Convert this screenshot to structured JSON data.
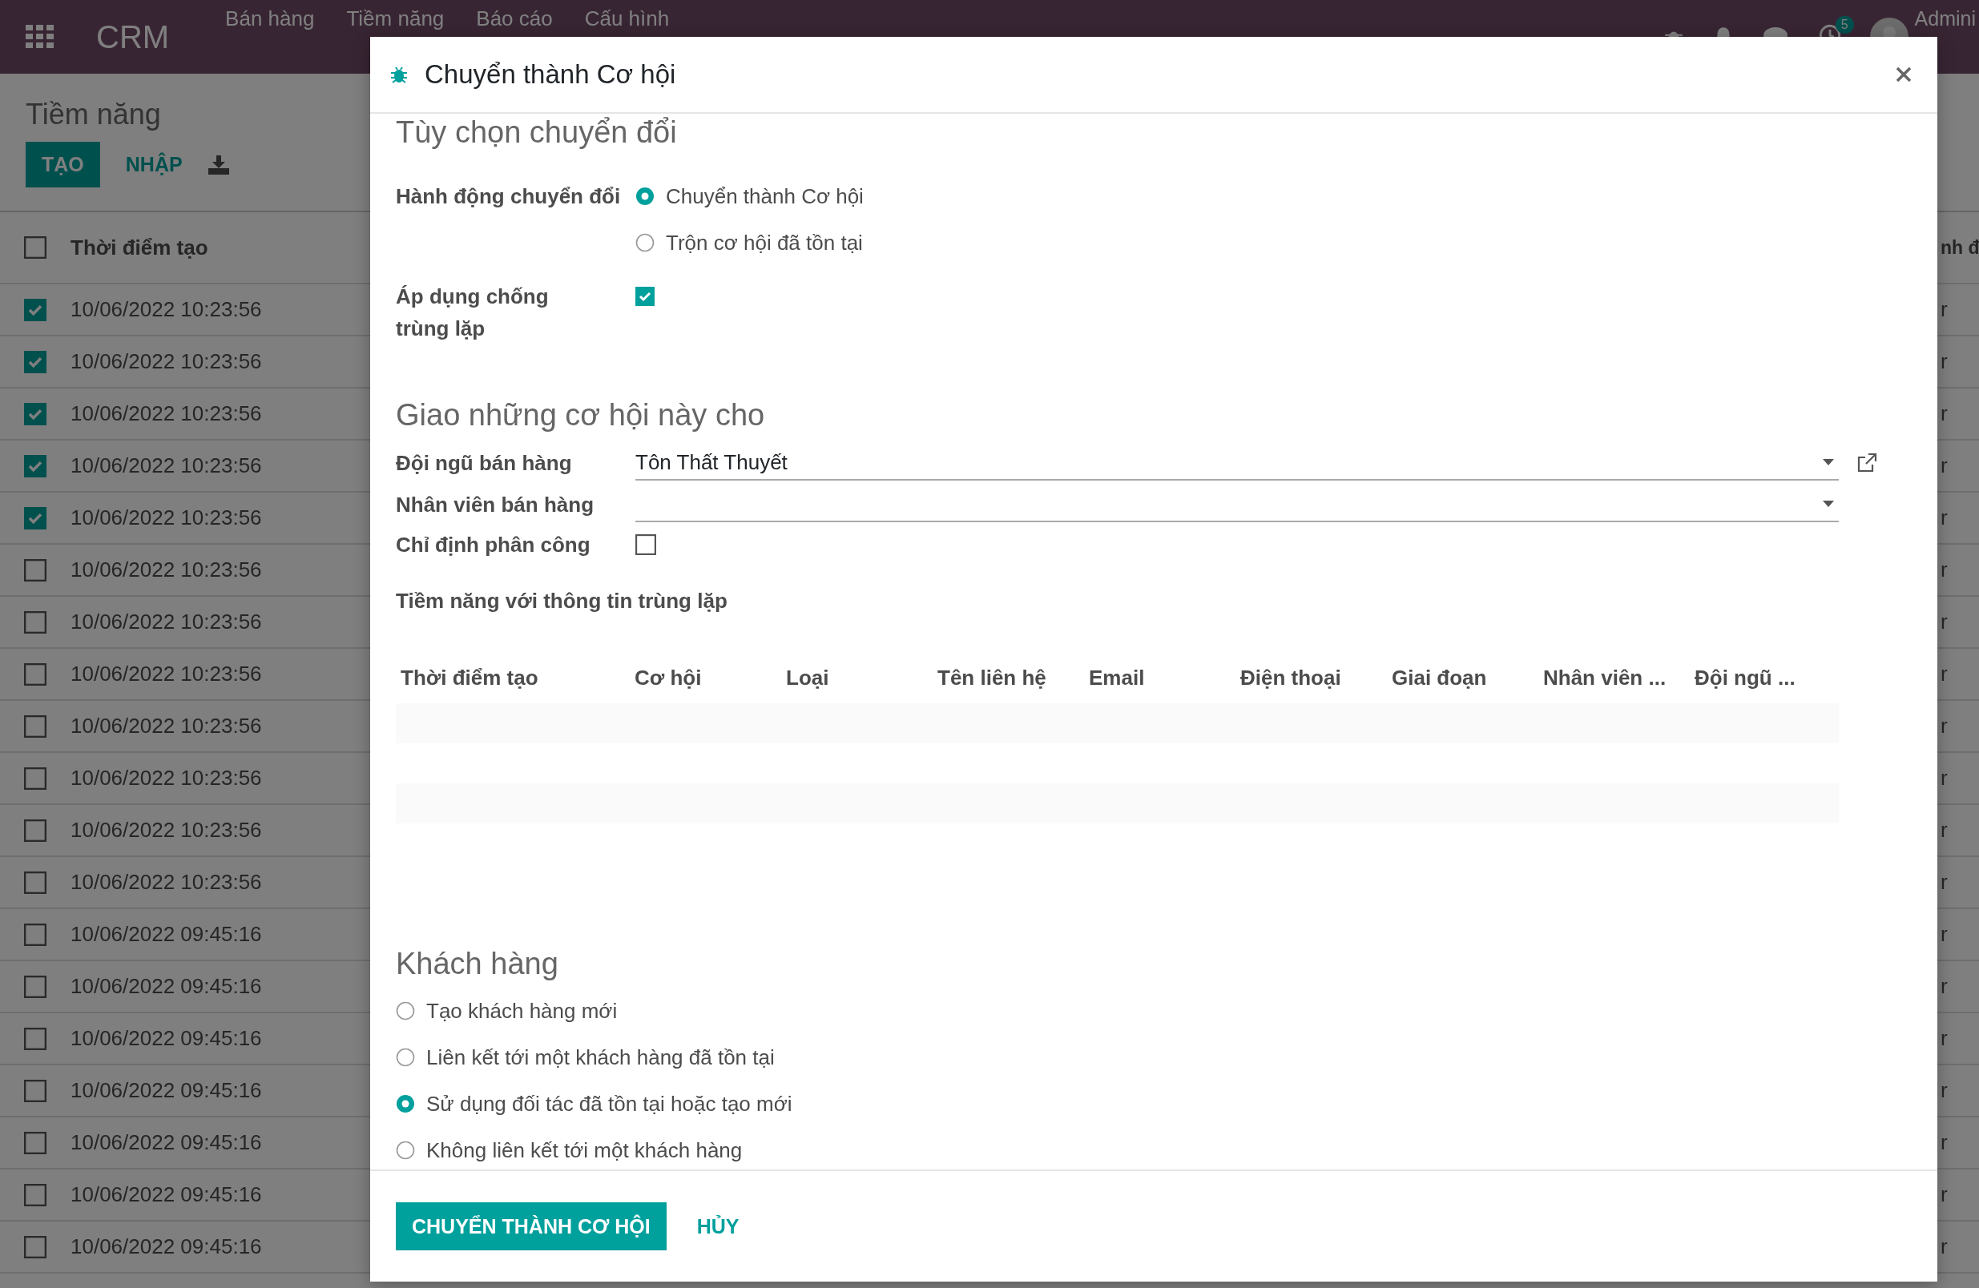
{
  "navbar": {
    "app_name": "CRM",
    "menu": [
      "Bán hàng",
      "Tiềm năng",
      "Báo cáo",
      "Cấu hình"
    ],
    "activity_count": "5",
    "user": "Admini"
  },
  "list_view": {
    "title": "Tiềm năng",
    "create_button": "TẠO",
    "import_button": "NHẬP",
    "columns": [
      "Thời điểm tạo",
      "nh đ"
    ],
    "select_all": false,
    "rows": [
      {
        "created": "10/06/2022 10:23:56",
        "column_2": "r",
        "selected": true
      },
      {
        "created": "10/06/2022 10:23:56",
        "column_2": "r",
        "selected": true
      },
      {
        "created": "10/06/2022 10:23:56",
        "column_2": "r",
        "selected": true
      },
      {
        "created": "10/06/2022 10:23:56",
        "column_2": "r",
        "selected": true
      },
      {
        "created": "10/06/2022 10:23:56",
        "column_2": "r",
        "selected": true
      },
      {
        "created": "10/06/2022 10:23:56",
        "column_2": "r",
        "selected": false
      },
      {
        "created": "10/06/2022 10:23:56",
        "column_2": "r",
        "selected": false
      },
      {
        "created": "10/06/2022 10:23:56",
        "column_2": "r",
        "selected": false
      },
      {
        "created": "10/06/2022 10:23:56",
        "column_2": "r",
        "selected": false
      },
      {
        "created": "10/06/2022 10:23:56",
        "column_2": "r",
        "selected": false
      },
      {
        "created": "10/06/2022 10:23:56",
        "column_2": "r",
        "selected": false
      },
      {
        "created": "10/06/2022 10:23:56",
        "column_2": "r",
        "selected": false
      },
      {
        "created": "10/06/2022 09:45:16",
        "column_2": "r",
        "selected": false
      },
      {
        "created": "10/06/2022 09:45:16",
        "column_2": "r",
        "selected": false
      },
      {
        "created": "10/06/2022 09:45:16",
        "column_2": "r",
        "selected": false
      },
      {
        "created": "10/06/2022 09:45:16",
        "column_2": "r",
        "selected": false
      },
      {
        "created": "10/06/2022 09:45:16",
        "column_2": "r",
        "selected": false
      },
      {
        "created": "10/06/2022 09:45:16",
        "column_2": "r",
        "selected": false
      },
      {
        "created": "10/06/2022 09:45:16",
        "column_2": "r",
        "selected": false
      }
    ]
  },
  "dialog": {
    "title": "Chuyển thành Cơ hội",
    "conversion": {
      "heading": "Tùy chọn chuyển đổi",
      "action_label": "Hành động chuyển đổi",
      "actions": [
        {
          "label": "Chuyển thành Cơ hội",
          "selected": true
        },
        {
          "label": "Trộn cơ hội đã tồn tại",
          "selected": false
        }
      ],
      "dedupe_label": "Áp dụng chống trùng lặp",
      "dedupe_checked": true
    },
    "assignment": {
      "heading": "Giao những cơ hội này cho",
      "team_label": "Đội ngũ bán hàng",
      "team_value": "Tôn Thất Thuyết",
      "salesperson_label": "Nhân viên bán hàng",
      "force_label": "Chỉ định phân công",
      "force_checked": false,
      "duplicates_label": "Tiềm năng với thông tin trùng lặp",
      "duplicate_columns": [
        "Thời điểm tạo",
        "Cơ hội",
        "Loại",
        "Tên liên hệ",
        "Email",
        "Điện thoại",
        "Giai đoạn",
        "Nhân viên ...",
        "Đội ngũ ..."
      ]
    },
    "customer": {
      "heading": "Khách hàng",
      "options": [
        {
          "label": "Tạo khách hàng mới",
          "selected": false
        },
        {
          "label": "Liên kết tới một khách hàng đã tồn tại",
          "selected": false
        },
        {
          "label": "Sử dụng đối tác đã tồn tại hoặc tạo mới",
          "selected": true
        },
        {
          "label": "Không liên kết tới một khách hàng",
          "selected": false
        }
      ]
    },
    "buttons": [
      {
        "kind": "primary",
        "label": "CHUYỂN THÀNH CƠ HỘI"
      },
      {
        "kind": "link",
        "label": "HỦY"
      }
    ]
  }
}
